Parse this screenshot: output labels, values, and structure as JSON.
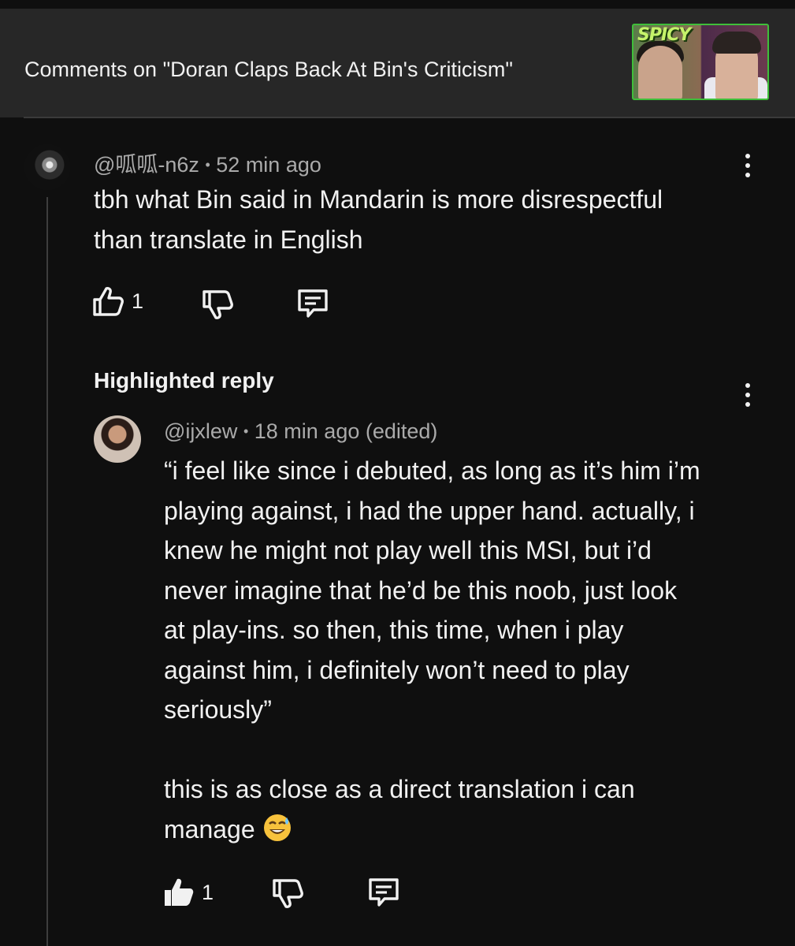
{
  "header": {
    "title": "Comments on \"Doran Claps Back At Bin's Criticism\"",
    "thumbnail_badge": "SPICY"
  },
  "comment": {
    "author": "@呱呱-n6z",
    "separator": "•",
    "time": "52 min ago",
    "text": "tbh what Bin said in Mandarin is more disrespectful\nthan translate in English",
    "like_count": "1"
  },
  "highlighted": {
    "label": "Highlighted reply"
  },
  "reply": {
    "author": "@ijxlew",
    "separator": "•",
    "time": "18 min ago (edited)",
    "text": "“i feel like since i debuted, as long as it’s him i’m\nplaying against, i had the upper hand. actually, i\nknew he might not play well this MSI, but i’d\nnever imagine that he’d be this noob, just look\nat play-ins. so then, this time, when i play\nagainst him, i definitely won’t need to play\nseriously”\n\nthis is as close as a direct translation i can\nmanage",
    "emoji": "sweat-smile-emoji",
    "like_count": "1"
  }
}
